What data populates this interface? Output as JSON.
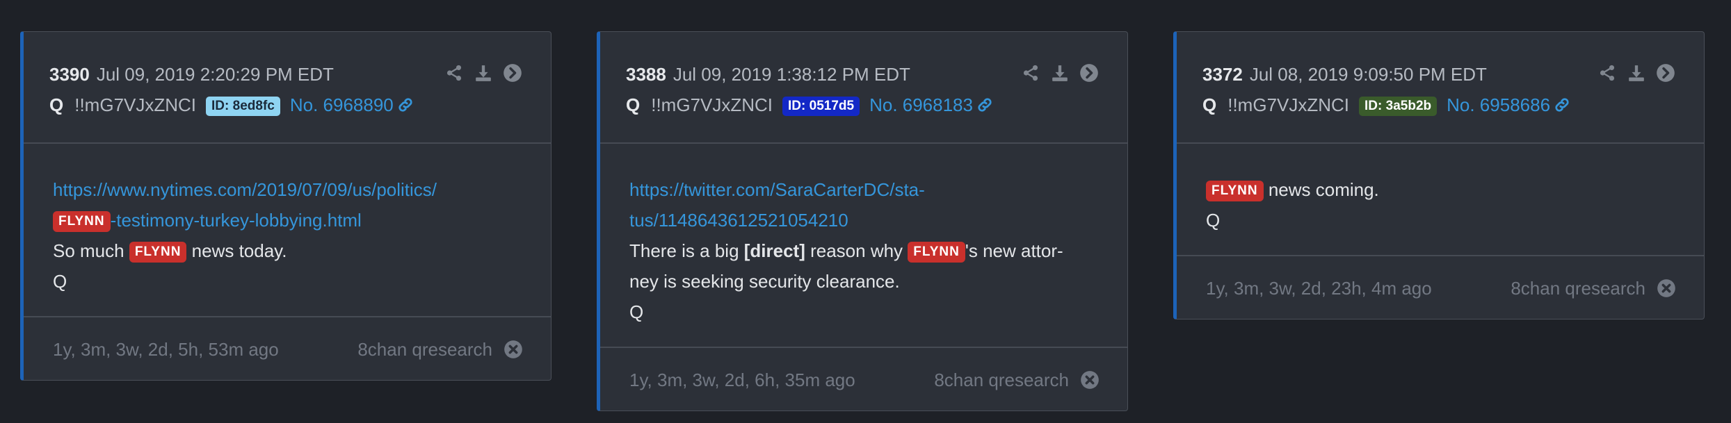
{
  "colors": {
    "page_background": "#1e2127",
    "card_background": "#2c3038",
    "accent_border": "#1d63b8",
    "link": "#3596db",
    "flynn_tag": "#c9302c"
  },
  "posts": [
    {
      "number": "3390",
      "date": "Jul 09, 2019 2:20:29 PM EDT",
      "author": "Q",
      "tripcode": "!!mG7VJxZNCI",
      "id_label": "ID: 8ed8fc",
      "id_color": "#8fd4f2",
      "no_label": "No. 6968890",
      "link_line1": "https://www.nytimes.com/2019/07/09/us/politics/",
      "tag": "FLYNN",
      "link_line2": "-testimony-turkey-lobbying.html",
      "text_before_tag": "So much ",
      "text_after_tag": " news today.",
      "signature": "Q",
      "ago": "1y, 3m, 3w, 2d, 5h, 53m ago",
      "source": "8chan qresearch"
    },
    {
      "number": "3388",
      "date": "Jul 09, 2019 1:38:12 PM EDT",
      "author": "Q",
      "tripcode": "!!mG7VJxZNCI",
      "id_label": "ID: 0517d5",
      "id_color": "#1328c6",
      "no_label": "No. 6968183",
      "link_line1": "https://twitter.com/SaraCarterDC/sta-",
      "link_line2": "tus/1148643612521054210",
      "text_line1_before": "There is a big ",
      "text_line1_bold": "[direct]",
      "text_line1_mid": " reason why ",
      "tag": "FLYNN",
      "text_line1_after": "'s new attor-",
      "text_line2": "ney is seeking security clearance.",
      "signature": "Q",
      "ago": "1y, 3m, 3w, 2d, 6h, 35m ago",
      "source": "8chan qresearch"
    },
    {
      "number": "3372",
      "date": "Jul 08, 2019 9:09:50 PM EDT",
      "author": "Q",
      "tripcode": "!!mG7VJxZNCI",
      "id_label": "ID: 3a5b2b",
      "id_color": "#3a5b2b",
      "no_label": "No. 6958686",
      "tag": "FLYNN",
      "text_after_tag": " news coming.",
      "signature": "Q",
      "ago": "1y, 3m, 3w, 2d, 23h, 4m ago",
      "source": "8chan qresearch"
    }
  ],
  "icons": {
    "share": "share-icon",
    "download": "download-icon",
    "open": "arrow-circle-right-icon",
    "link": "link-icon",
    "close": "close-circle-icon"
  }
}
